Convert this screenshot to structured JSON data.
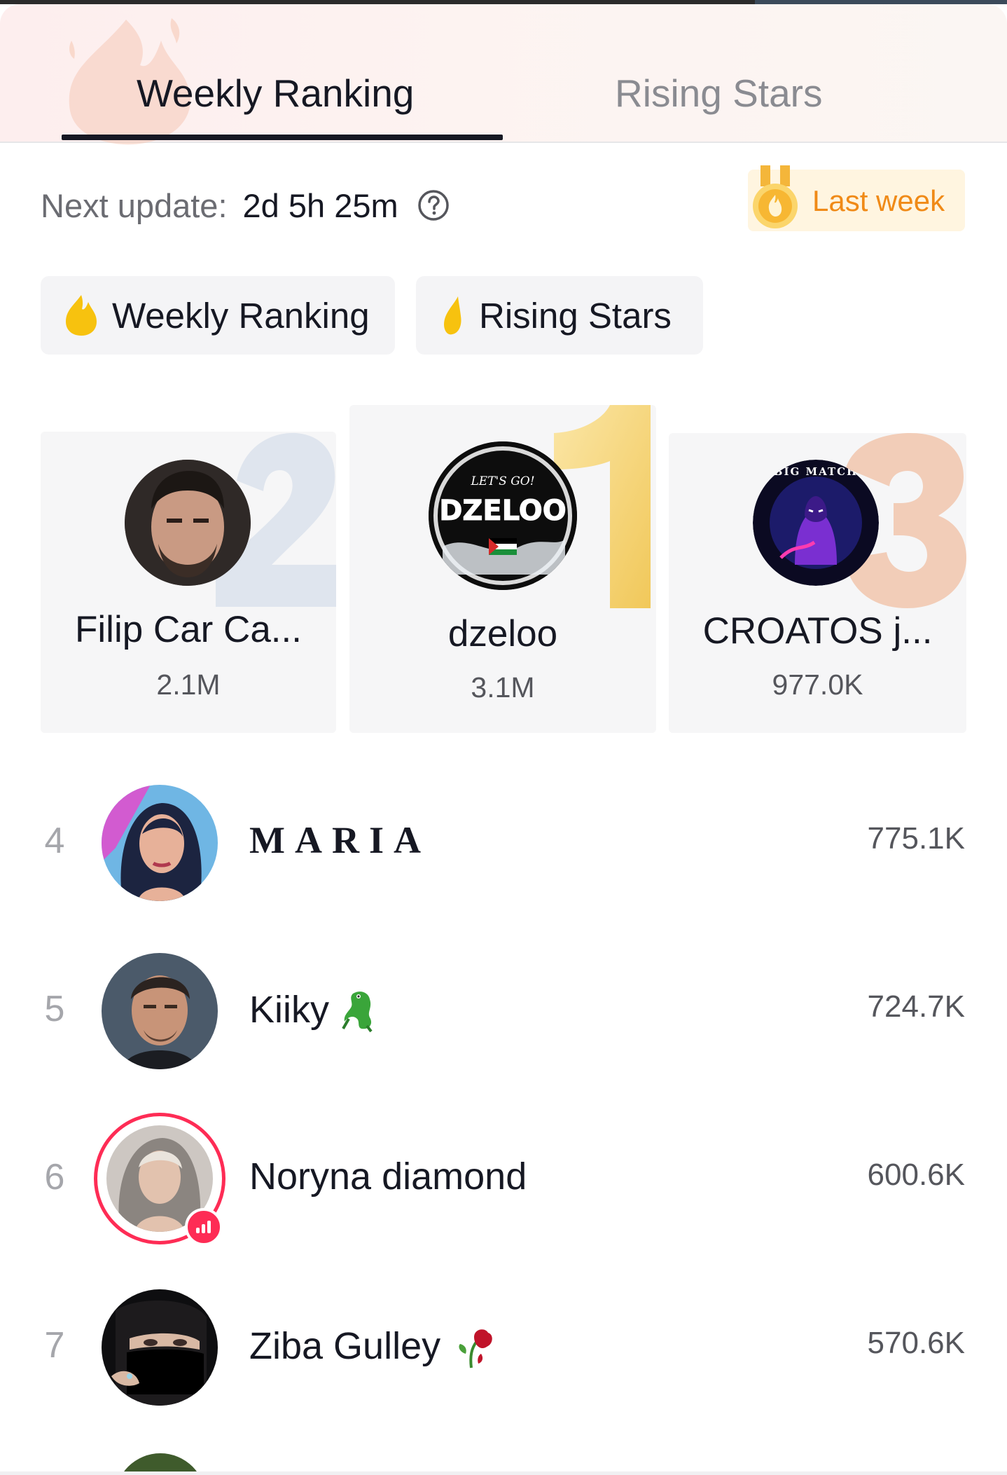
{
  "tabs": [
    {
      "label": "Weekly Ranking",
      "active": true
    },
    {
      "label": "Rising Stars",
      "active": false
    }
  ],
  "update": {
    "label": "Next update:",
    "value": "2d 5h 25m",
    "help_icon": "question-circle-icon"
  },
  "last_week": {
    "label": "Last week",
    "icon": "medal-icon"
  },
  "chips": [
    {
      "label": "Weekly Ranking",
      "icon": "flame-icon",
      "selected": true
    },
    {
      "label": "Rising Stars",
      "icon": "flame-small-icon",
      "selected": false
    }
  ],
  "podium": [
    {
      "rank": "2",
      "name": "Filip Car Ca...",
      "score": "2.1M"
    },
    {
      "rank": "1",
      "name": "dzeloo",
      "score": "3.1M",
      "avatar_text": "DZELOO",
      "avatar_caption": "LET'S GO!"
    },
    {
      "rank": "3",
      "name": "CROATOS j...",
      "score": "977.0K",
      "avatar_text": "BIG MATCH"
    }
  ],
  "list": [
    {
      "rank": "4",
      "name": "MARIA",
      "score": "775.1K",
      "emoji": null,
      "live": false
    },
    {
      "rank": "5",
      "name": "Kiiky",
      "score": "724.7K",
      "emoji": "crocodile-emoji",
      "live": false
    },
    {
      "rank": "6",
      "name": "Noryna diamond",
      "score": "600.6K",
      "emoji": null,
      "live": true
    },
    {
      "rank": "7",
      "name": "Ziba Gulley",
      "score": "570.6K",
      "emoji": "wilted-rose-emoji",
      "live": false
    }
  ],
  "colors": {
    "accent_orange": "#f08a17",
    "gold": "#f3c64b",
    "silver": "#d7dde8",
    "bronze": "#f1c3a9",
    "live_pink": "#fe2c55",
    "text_primary": "#161823",
    "text_secondary": "#8a8b91"
  }
}
